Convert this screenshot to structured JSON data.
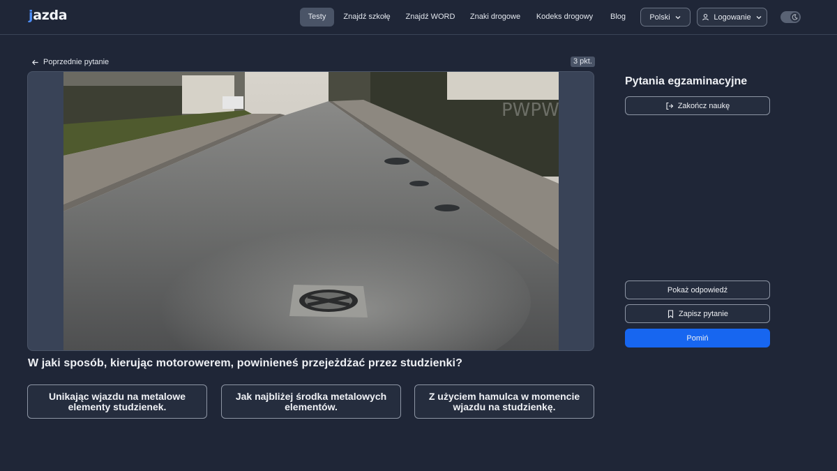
{
  "header": {
    "logo": "jazda",
    "nav": [
      "Testy",
      "Znajdź szkołę",
      "Znajdź WORD",
      "Znaki drogowe",
      "Kodeks drogowy",
      "Blog"
    ],
    "language": "Polski",
    "login": "Logowanie"
  },
  "question": {
    "prev_label": "Poprzednie pytanie",
    "points": "3 pkt.",
    "text": "W jaki sposób, kierując motorowerem, powinieneś przejeżdżać przez studzienki?",
    "image_watermark": "PWPW",
    "answers": [
      "Unikając wjazdu na metalowe elementy studzienek.",
      "Jak najbliżej środka metalowych elementów.",
      "Z użyciem hamulca w momencie wjazdu na studzienkę."
    ]
  },
  "sidebar": {
    "title": "Pytania egzaminacyjne",
    "finish": "Zakończ naukę",
    "show_answer": "Pokaż odpowiedź",
    "save": "Zapisz pytanie",
    "skip": "Pomiń"
  },
  "colors": {
    "background": "#1f2637",
    "accent": "#1766f0",
    "logo_accent": "#4d8df6"
  },
  "icons": [
    "arrow-left-icon",
    "user-icon",
    "chevron-down-icon",
    "moon-icon",
    "logout-icon",
    "bookmark-icon"
  ]
}
